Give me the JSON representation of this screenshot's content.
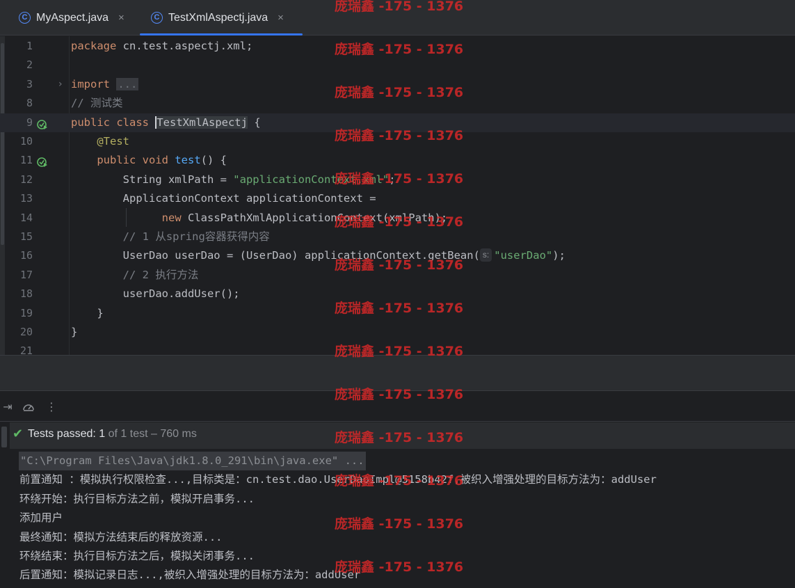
{
  "tabs": [
    {
      "icon": "C",
      "label": "MyAspect.java",
      "close": "×",
      "active": false
    },
    {
      "icon": "C",
      "label": "TestXmlAspectj.java",
      "close": "×",
      "active": true
    }
  ],
  "editor": {
    "lines": [
      {
        "n": "1",
        "html": "<span class=\"kw\">package</span> cn.test.aspectj.xml;"
      },
      {
        "n": "2",
        "html": ""
      },
      {
        "n": "3",
        "html": "<span class=\"kw\">import</span> <span class=\"fold\">...</span>",
        "fold": "›"
      },
      {
        "n": "8",
        "html": "<span class=\"cm\">// 测试类</span>"
      },
      {
        "n": "9",
        "html": "<span class=\"kw\">public class</span> <span class=\"caret\"></span><span class=\"cls-hl\">TestXmlAspectj</span> {",
        "run": true,
        "current": true
      },
      {
        "n": "10",
        "html": "    <span class=\"ann\">@Test</span>"
      },
      {
        "n": "11",
        "html": "    <span class=\"kw\">public void</span> <span class=\"fn\">test</span>() {",
        "run": true
      },
      {
        "n": "12",
        "html": "        String xmlPath = <span class=\"str\">\"applicationContext.xml\"</span>;"
      },
      {
        "n": "13",
        "html": "        ApplicationContext applicationContext ="
      },
      {
        "n": "14",
        "html": "              <span class=\"kw\">new</span> ClassPathXmlApplicationContext(xmlPath);"
      },
      {
        "n": "15",
        "html": "        <span class=\"cm\">// 1 从spring容器获得内容</span>"
      },
      {
        "n": "16",
        "html": "        UserDao userDao = (UserDao) applicationContext.getBean(<span class=\"hint\">s:</span><span class=\"str\">\"userDao\"</span>);"
      },
      {
        "n": "17",
        "html": "        <span class=\"cm\">// 2 执行方法</span>"
      },
      {
        "n": "18",
        "html": "        userDao.addUser();"
      },
      {
        "n": "19",
        "html": "    }"
      },
      {
        "n": "20",
        "html": "}"
      },
      {
        "n": "21",
        "html": ""
      }
    ]
  },
  "tests": {
    "status": "Tests passed:",
    "count": "1",
    "rest": "of 1 test – 760 ms"
  },
  "console": {
    "lines": [
      "\"C:\\Program Files\\Java\\jdk1.8.0_291\\bin\\java.exe\" ...",
      "前置通知 ：模拟执行权限检查...,目标类是：cn.test.dao.UserDaoImpl@5158b42f,被织入增强处理的目标方法为：addUser",
      "环绕开始：执行目标方法之前，模拟开启事务...",
      "添加用户",
      "最终通知：模拟方法结束后的释放资源...",
      "环绕结束：执行目标方法之后，模拟关闭事务...",
      "后置通知：模拟记录日志...,被织入增强处理的目标方法为：addUser"
    ]
  },
  "watermark": "庞瑞鑫 -175 - 1376"
}
